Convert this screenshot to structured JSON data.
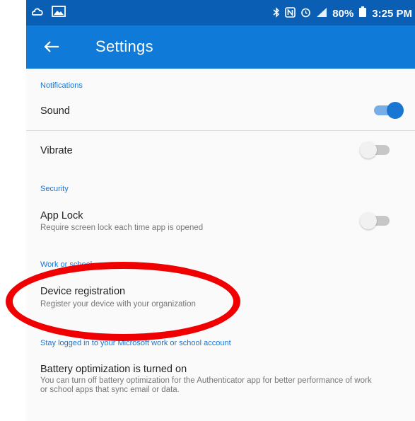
{
  "status_bar": {
    "left_icons": [
      "weather-icon",
      "image-icon"
    ],
    "battery": "80%",
    "time": "3:25 PM"
  },
  "app_bar": {
    "title": "Settings",
    "back_icon": "arrow-left-icon"
  },
  "sections": {
    "notifications": {
      "header": "Notifications",
      "items": [
        {
          "title": "Sound",
          "toggle": "on"
        },
        {
          "title": "Vibrate",
          "toggle": "off"
        }
      ]
    },
    "security": {
      "header": "Security",
      "items": [
        {
          "title": "App Lock",
          "subtitle": "Require screen lock each time app is opened",
          "toggle": "off"
        }
      ]
    },
    "work_school": {
      "header": "Work or school",
      "items": [
        {
          "title": "Device registration",
          "subtitle": "Register your device with your organization"
        }
      ]
    },
    "stay_logged": {
      "header": "Stay logged in to your Microsoft work or school account",
      "items": [
        {
          "title": "Battery optimization is turned on",
          "subtitle": "You can turn off battery optimization for the Authenticator app for better performance of work or school apps that sync email or data."
        }
      ]
    }
  },
  "colors": {
    "status_bar": "#0a5fb4",
    "app_bar": "#0f7ad8",
    "accent": "#1976d2",
    "annotation": "#f00000"
  }
}
